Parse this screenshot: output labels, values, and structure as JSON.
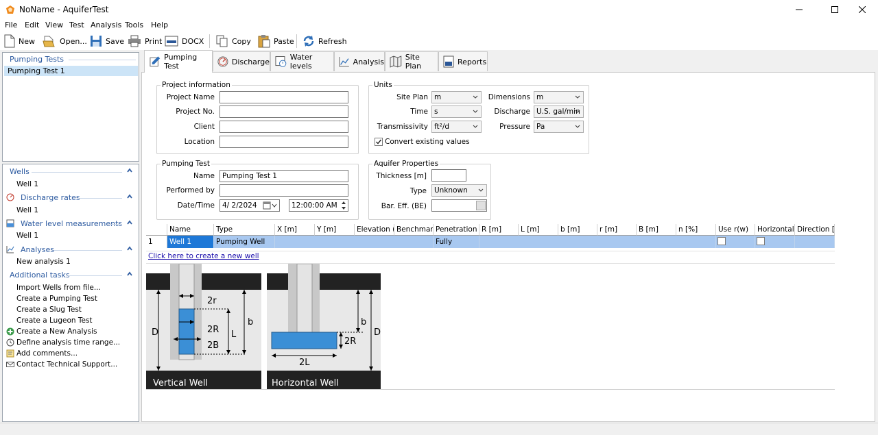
{
  "window": {
    "title": "NoName - AquiferTest"
  },
  "menu": [
    "File",
    "Edit",
    "View",
    "Test",
    "Analysis",
    "Tools",
    "Help"
  ],
  "toolbar": {
    "new": "New",
    "open": "Open...",
    "save": "Save",
    "print": "Print",
    "docx": "DOCX",
    "copy": "Copy",
    "paste": "Paste",
    "refresh": "Refresh"
  },
  "pumping_tests": {
    "header": "Pumping Tests",
    "items": [
      "Pumping Test 1"
    ]
  },
  "sidebar": {
    "wells": {
      "header": "Wells",
      "items": [
        "Well 1"
      ]
    },
    "discharge": {
      "header": "Discharge rates",
      "items": [
        "Well 1"
      ]
    },
    "water_levels": {
      "header": "Water level measurements",
      "items": [
        "Well 1"
      ]
    },
    "analyses": {
      "header": "Analyses",
      "items": [
        "New analysis 1"
      ]
    },
    "additional": {
      "header": "Additional tasks",
      "items": [
        "Import Wells from file...",
        "Create a Pumping Test",
        "Create a Slug Test",
        "Create a Lugeon Test",
        "Create a New Analysis",
        "Define analysis time range...",
        "Add comments...",
        "Contact Technical Support..."
      ]
    }
  },
  "tabs": [
    "Pumping Test",
    "Discharge",
    "Water levels",
    "Analysis",
    "Site Plan",
    "Reports"
  ],
  "project_info": {
    "title": "Project information",
    "name_label": "Project Name",
    "name_value": "",
    "no_label": "Project No.",
    "no_value": "",
    "client_label": "Client",
    "client_value": "",
    "location_label": "Location",
    "location_value": ""
  },
  "units": {
    "title": "Units",
    "site_plan_label": "Site Plan",
    "site_plan_value": "m",
    "time_label": "Time",
    "time_value": "s",
    "transmissivity_label": "Transmissivity",
    "transmissivity_value": "ft²/d",
    "dimensions_label": "Dimensions",
    "dimensions_value": "m",
    "discharge_label": "Discharge",
    "discharge_value": "U.S. gal/min",
    "pressure_label": "Pressure",
    "pressure_value": "Pa",
    "convert_label": "Convert existing values",
    "convert_checked": true
  },
  "pumping_test": {
    "title": "Pumping Test",
    "name_label": "Name",
    "name_value": "Pumping Test 1",
    "performed_label": "Performed by",
    "performed_value": "",
    "datetime_label": "Date/Time",
    "date_value": "4/  2/2024",
    "time_value": "12:00:00 AM"
  },
  "aquifer": {
    "title": "Aquifer Properties",
    "thickness_label": "Thickness [m]",
    "thickness_value": "",
    "type_label": "Type",
    "type_value": "Unknown",
    "bar_label": "Bar. Eff. (BE)",
    "bar_value": ""
  },
  "grid": {
    "columns": [
      "",
      "Name",
      "Type",
      "X [m]",
      "Y [m]",
      "Elevation (amsl)",
      "Benchmark [m]",
      "Penetration",
      "R [m]",
      "L [m]",
      "b [m]",
      "r [m]",
      "B [m]",
      "n [%]",
      "Use r(w)",
      "Horizontal well",
      "Direction [°]"
    ],
    "rows": [
      {
        "index": "1",
        "name": "Well 1",
        "type": "Pumping Well",
        "penetration": "Fully"
      }
    ],
    "new_well_link": "Click here to create a new well"
  },
  "diagram": {
    "vertical": {
      "caption": "Vertical Well",
      "labels": [
        "2r",
        "2R",
        "2B",
        "D",
        "L",
        "b"
      ]
    },
    "horizontal": {
      "caption": "Horizontal Well",
      "labels": [
        "b",
        "2R",
        "D",
        "2L"
      ]
    }
  }
}
